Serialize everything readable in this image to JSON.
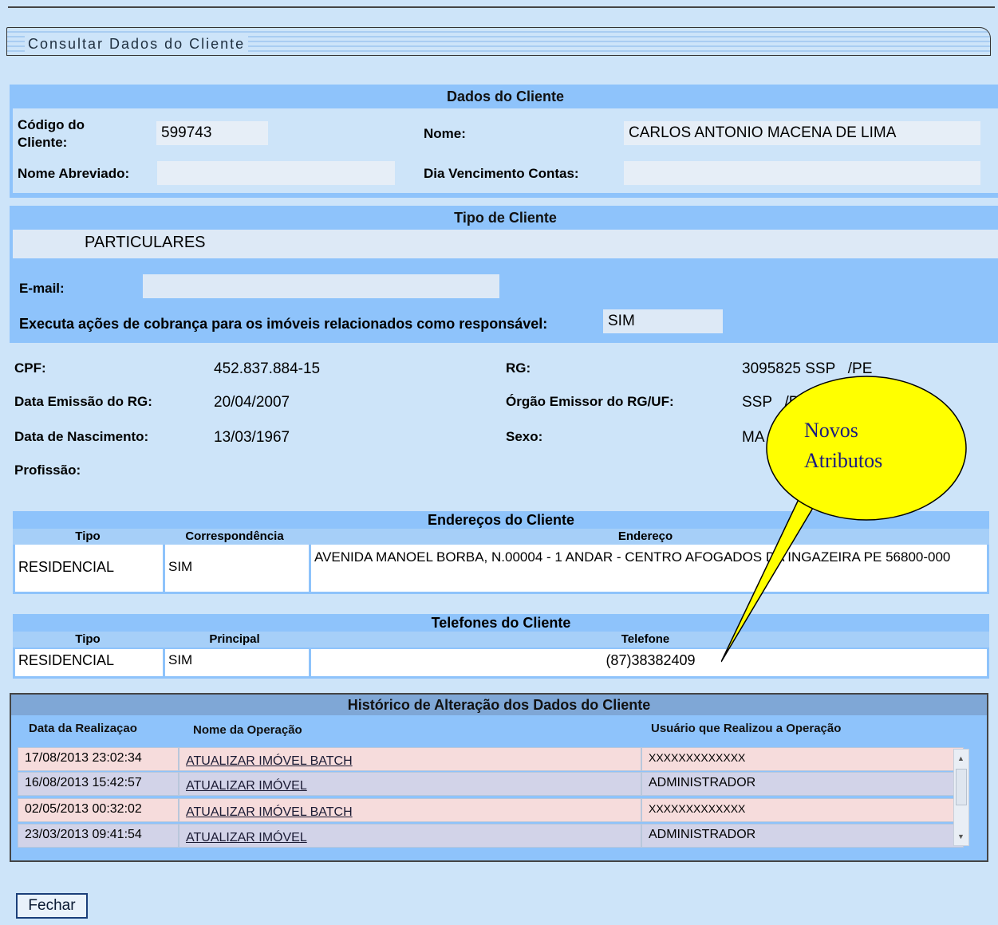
{
  "title": "Consultar Dados do Cliente",
  "dados": {
    "header": "Dados do Cliente",
    "codigo_label": "Código do Cliente:",
    "codigo_value": "599743",
    "nome_label": "Nome:",
    "nome_value": "CARLOS ANTONIO MACENA DE LIMA",
    "abrev_label": "Nome Abreviado:",
    "abrev_value": "",
    "venc_label": "Dia Vencimento Contas:",
    "venc_value": ""
  },
  "tipo": {
    "header": "Tipo de Cliente",
    "value": "PARTICULARES",
    "email_label": "E-mail:",
    "email_value": "",
    "executa_label": "Executa ações de cobrança para os imóveis relacionados como responsável:",
    "executa_value": "SIM"
  },
  "pessoa": {
    "cpf_label": "CPF:",
    "cpf_value": "452.837.884-15",
    "rg_label": "RG:",
    "rg_value": "3095825 SSP   /PE",
    "emissao_label": "Data Emissão do RG:",
    "emissao_value": "20/04/2007",
    "orgao_label": "Órgão Emissor do RG/UF:",
    "orgao_value": "SSP   /PE",
    "nasc_label": "Data de Nascimento:",
    "nasc_value": "13/03/1967",
    "sexo_label": "Sexo:",
    "sexo_value": "MA",
    "profissao_label": "Profissão:"
  },
  "enderecos": {
    "header": "Endereços do Cliente",
    "col_tipo": "Tipo",
    "col_corr": "Correspondência",
    "col_end": "Endereço",
    "row": {
      "tipo": "RESIDENCIAL",
      "corr": "SIM",
      "endereco": "AVENIDA MANOEL BORBA, N.00004 - 1 ANDAR - CENTRO AFOGADOS DA INGAZEIRA PE 56800-000"
    }
  },
  "telefones": {
    "header": "Telefones do Cliente",
    "col_tipo": "Tipo",
    "col_principal": "Principal",
    "col_tel": "Telefone",
    "row": {
      "tipo": "RESIDENCIAL",
      "principal": "SIM",
      "telefone": "(87)38382409"
    }
  },
  "historico": {
    "header": "Histórico de Alteração dos Dados do Cliente",
    "col_data": "Data da Realizaçao",
    "col_op": "Nome da Operação",
    "col_user": "Usuário que Realizou a Operação",
    "rows": [
      {
        "data": "17/08/2013 23:02:34",
        "op": "ATUALIZAR IMÓVEL BATCH",
        "user": "XXXXXXXXXXXXX"
      },
      {
        "data": "16/08/2013 15:42:57",
        "op": "ATUALIZAR IMÓVEL",
        "user": "ADMINISTRADOR"
      },
      {
        "data": "02/05/2013 00:32:02",
        "op": "ATUALIZAR IMÓVEL BATCH",
        "user": "XXXXXXXXXXXXX"
      },
      {
        "data": "23/03/2013 09:41:54",
        "op": "ATUALIZAR IMÓVEL",
        "user": "ADMINISTRADOR"
      }
    ]
  },
  "callout": {
    "line1": "Novos",
    "line2": "Atributos"
  },
  "buttons": {
    "fechar": "Fechar"
  }
}
